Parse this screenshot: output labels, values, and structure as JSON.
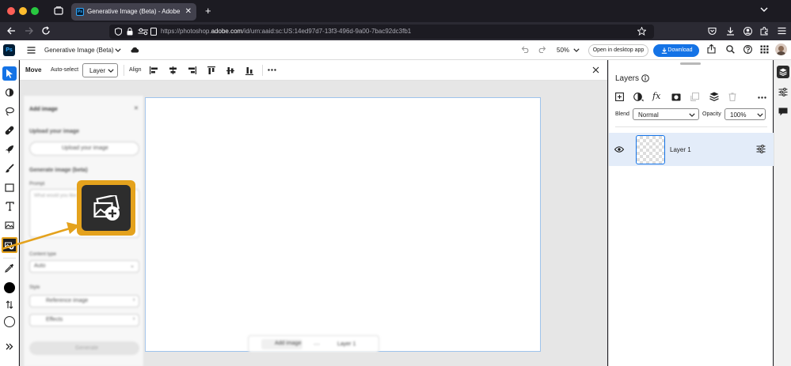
{
  "browser": {
    "tab_title": "Generative Image (Beta) - Adobe",
    "tab_favicon_text": "Ps",
    "url_prefix": "https://photoshop.",
    "url_domain": "adobe.com",
    "url_suffix": "/id/urn:aaid:sc:US:14ed97d7-13f3-496d-9a00-7bac92dc3fb1"
  },
  "appbar": {
    "logo_text": "Ps",
    "doc_title": "Generative Image (Beta)",
    "zoom": "50%",
    "open_desktop_label": "Open in desktop app",
    "download_label": "Download",
    "accent": "#1473e6"
  },
  "options": {
    "tool_name": "Move",
    "auto_select_label": "Auto-select",
    "layer_select": "Layer",
    "align_label": "Align"
  },
  "add_image_panel": {
    "title": "Add image",
    "upload_heading": "Upload your image",
    "upload_button": "Upload your image",
    "generate_heading": "Generate image (beta)",
    "prompt_label": "Prompt",
    "prompt_placeholder": "What would you like to see?",
    "content_type_label": "Content type",
    "content_type_value": "Auto",
    "style_label": "Style",
    "reference_image_label": "Reference image",
    "effects_label": "Effects",
    "generate_button": "Generate"
  },
  "bottom_bar": {
    "add_image_label": "Add image",
    "layer_label": "Layer 1"
  },
  "layers_panel": {
    "title": "Layers",
    "blend_label": "Blend",
    "blend_value": "Normal",
    "opacity_label": "Opacity",
    "opacity_value": "100%",
    "layers": [
      {
        "name": "Layer 1"
      }
    ]
  },
  "callout": {
    "color": "#e4a21d",
    "icon": "generative-image-icon"
  }
}
